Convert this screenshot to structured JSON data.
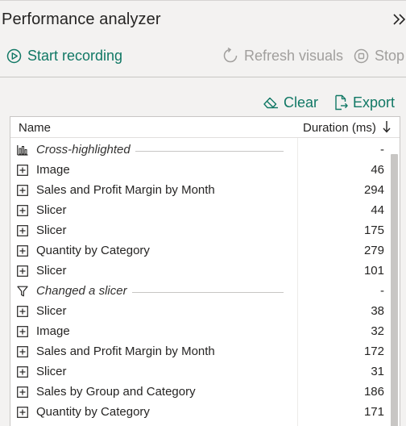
{
  "panel": {
    "title": "Performance analyzer",
    "collapse_icon": "double-chevron-right-icon"
  },
  "actions": {
    "start_label": "Start recording",
    "refresh_label": "Refresh visuals",
    "stop_label": "Stop"
  },
  "toolbar": {
    "clear_label": "Clear",
    "export_label": "Export"
  },
  "table": {
    "col_name": "Name",
    "col_duration": "Duration (ms)",
    "sort": "descending",
    "rows": [
      {
        "type": "group",
        "icon": "bar-chart-icon",
        "label": "Cross-highlighted",
        "duration": "-"
      },
      {
        "type": "item",
        "icon": "expand-plus-icon",
        "label": "Image",
        "duration": "46"
      },
      {
        "type": "item",
        "icon": "expand-plus-icon",
        "label": "Sales and Profit Margin by Month",
        "duration": "294"
      },
      {
        "type": "item",
        "icon": "expand-plus-icon",
        "label": "Slicer",
        "duration": "44"
      },
      {
        "type": "item",
        "icon": "expand-plus-icon",
        "label": "Slicer",
        "duration": "175"
      },
      {
        "type": "item",
        "icon": "expand-plus-icon",
        "label": "Quantity by Category",
        "duration": "279"
      },
      {
        "type": "item",
        "icon": "expand-plus-icon",
        "label": "Slicer",
        "duration": "101"
      },
      {
        "type": "group",
        "icon": "filter-icon",
        "label": "Changed a slicer",
        "duration": "-"
      },
      {
        "type": "item",
        "icon": "expand-plus-icon",
        "label": "Slicer",
        "duration": "38"
      },
      {
        "type": "item",
        "icon": "expand-plus-icon",
        "label": "Image",
        "duration": "32"
      },
      {
        "type": "item",
        "icon": "expand-plus-icon",
        "label": "Sales and Profit Margin by Month",
        "duration": "172"
      },
      {
        "type": "item",
        "icon": "expand-plus-icon",
        "label": "Slicer",
        "duration": "31"
      },
      {
        "type": "item",
        "icon": "expand-plus-icon",
        "label": "Sales by Group and Category",
        "duration": "186"
      },
      {
        "type": "item",
        "icon": "expand-plus-icon",
        "label": "Quantity by Category",
        "duration": "171"
      }
    ]
  },
  "colors": {
    "accent": "#117865",
    "disabled": "#a19f9d",
    "panel_bg": "#f3f2f1",
    "table_bg": "#ffffff",
    "scrollbar": "#c8c6c4"
  }
}
